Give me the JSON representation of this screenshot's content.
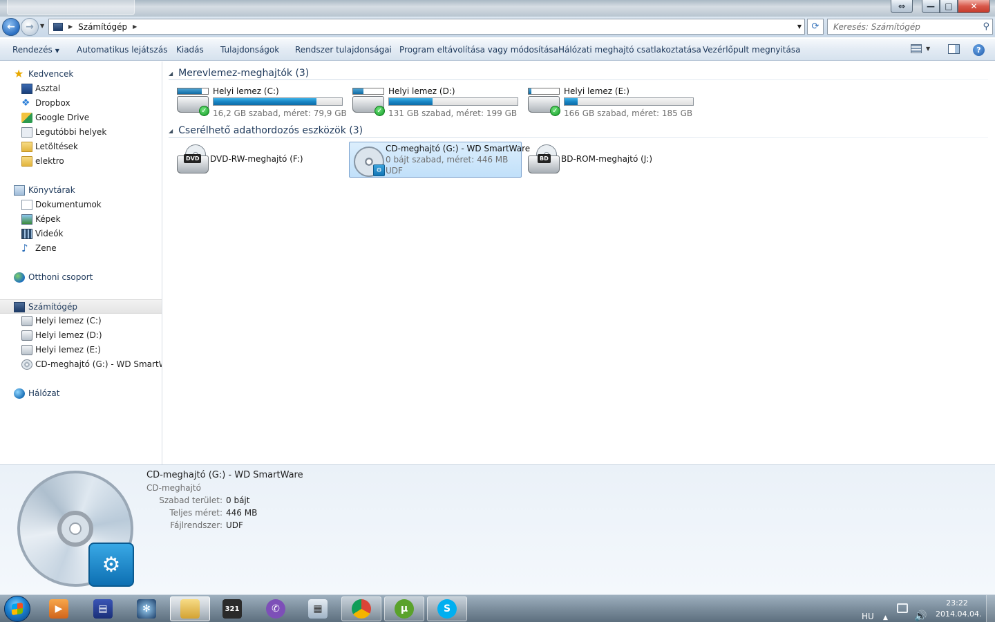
{
  "window": {
    "title_tab": "",
    "buttons": {
      "restore_left": "⇔",
      "minimize": "—",
      "maximize": "□",
      "close": "✕"
    }
  },
  "address": {
    "path": [
      "Számítógép"
    ],
    "search_placeholder": "Keresés: Számítógép"
  },
  "commands": [
    {
      "label": "Rendezés",
      "has_dropdown": true
    },
    {
      "label": "Automatikus lejátszás"
    },
    {
      "label": "Kiadás"
    },
    {
      "label": "Tulajdonságok"
    },
    {
      "label": "Rendszer tulajdonságai"
    },
    {
      "label": "Program eltávolítása vagy módosítása"
    },
    {
      "label": "Hálózati meghajtó csatlakoztatása"
    },
    {
      "label": "Vezérlőpult megnyitása"
    }
  ],
  "sidebar": {
    "favorites": {
      "label": "Kedvencek",
      "icon": "star-icon"
    },
    "favorite_items": [
      {
        "label": "Asztal",
        "icon": "desktop-icon"
      },
      {
        "label": "Dropbox",
        "icon": "dropbox-icon"
      },
      {
        "label": "Google Drive",
        "icon": "google-drive-icon"
      },
      {
        "label": "Legutóbbi helyek",
        "icon": "recent-places-icon"
      },
      {
        "label": "Letöltések",
        "icon": "downloads-folder-icon"
      },
      {
        "label": "elektro",
        "icon": "folder-icon"
      }
    ],
    "libraries": {
      "label": "Könyvtárak",
      "icon": "libraries-icon"
    },
    "library_items": [
      {
        "label": "Dokumentumok",
        "icon": "documents-icon"
      },
      {
        "label": "Képek",
        "icon": "pictures-icon"
      },
      {
        "label": "Videók",
        "icon": "videos-icon"
      },
      {
        "label": "Zene",
        "icon": "music-icon"
      }
    ],
    "homegroup": {
      "label": "Otthoni csoport",
      "icon": "homegroup-icon"
    },
    "computer": {
      "label": "Számítógép",
      "icon": "computer-icon",
      "selected": true
    },
    "computer_items": [
      {
        "label": "Helyi lemez (C:)",
        "icon": "hard-drive-icon"
      },
      {
        "label": "Helyi lemez (D:)",
        "icon": "hard-drive-icon"
      },
      {
        "label": "Helyi lemez (E:)",
        "icon": "hard-drive-icon"
      },
      {
        "label": "CD-meghajtó (G:) - WD SmartWare",
        "icon": "cd-drive-icon"
      }
    ],
    "network": {
      "label": "Hálózat",
      "icon": "network-icon"
    }
  },
  "groups": {
    "hdd_title": "Merevlemez-meghajtók (3)",
    "removable_title": "Cserélhető adathordozós eszközök (3)"
  },
  "hard_drives": [
    {
      "name": "Helyi lemez (C:)",
      "info": "16,2 GB szabad, méret: 79,9 GB",
      "used_fraction": 0.8
    },
    {
      "name": "Helyi lemez (D:)",
      "info": "131 GB szabad, méret: 199 GB",
      "used_fraction": 0.34
    },
    {
      "name": "Helyi lemez (E:)",
      "info": "166 GB szabad, méret: 185 GB",
      "used_fraction": 0.1
    }
  ],
  "removable": [
    {
      "name": "DVD-RW-meghajtó (F:)",
      "badge": "DVD",
      "icon": "dvd-drive-icon"
    },
    {
      "name": "CD-meghajtó (G:) - WD SmartWare",
      "info1": "0 bájt szabad, méret: 446 MB",
      "info2": "UDF",
      "icon": "smartware-cd-icon",
      "selected": true
    },
    {
      "name": "BD-ROM-meghajtó (J:)",
      "badge": "BD",
      "icon": "bd-drive-icon"
    }
  ],
  "details": {
    "title": "CD-meghajtó (G:) - WD SmartWare",
    "subtitle": "CD-meghajtó",
    "rows": [
      {
        "key": "Szabad terület:",
        "value": "0 bájt"
      },
      {
        "key": "Teljes méret:",
        "value": "446 MB"
      },
      {
        "key": "Fájlrendszer:",
        "value": "UDF"
      }
    ]
  },
  "taskbar": {
    "items": [
      {
        "icon": "media-player-icon",
        "state": "pinned"
      },
      {
        "icon": "save-disk-icon",
        "state": "pinned"
      },
      {
        "icon": "fan-app-icon",
        "state": "pinned"
      },
      {
        "icon": "windows-explorer-icon",
        "state": "active"
      },
      {
        "icon": "video-editor-icon",
        "state": "pinned"
      },
      {
        "icon": "viber-icon",
        "state": "pinned"
      },
      {
        "icon": "calculator-icon",
        "state": "pinned"
      },
      {
        "icon": "chrome-icon",
        "state": "open"
      },
      {
        "icon": "utorrent-icon",
        "state": "open"
      },
      {
        "icon": "skype-icon",
        "state": "open"
      }
    ],
    "language": "HU",
    "time": "23:22",
    "date": "2014.04.04."
  },
  "colors": {
    "accent_text": "#1e395b",
    "drive_bar": "#1886c5",
    "selection": "#c1e0fa"
  }
}
